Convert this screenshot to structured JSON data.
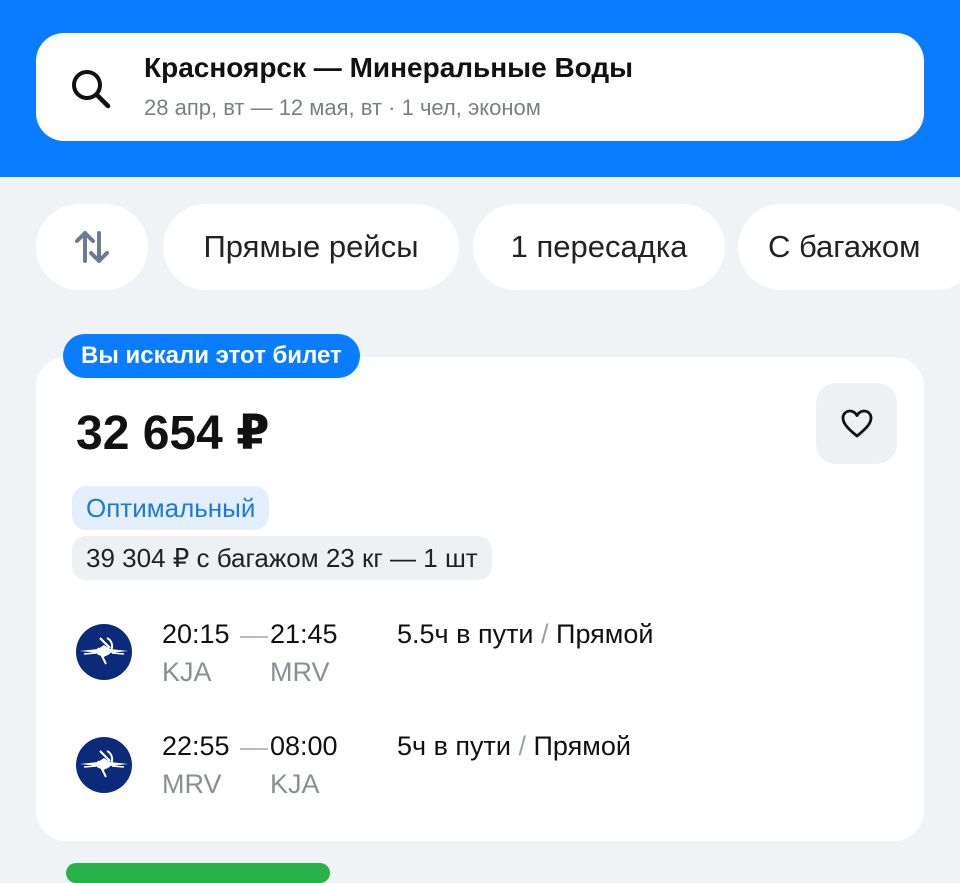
{
  "search": {
    "route": "Красноярск — Минеральные Воды",
    "details": "28 апр, вт — 12 мая, вт · 1 чел, эконом"
  },
  "filters": {
    "sort_icon": "sort-arrows-icon",
    "chips": [
      "Прямые рейсы",
      "1 пересадка",
      "С багажом"
    ]
  },
  "ticket": {
    "badge": "Вы искали этот билет",
    "price": "32 654 ₽",
    "tag": "Оптимальный",
    "baggage_price": "39 304 ₽ с багажом 23 кг — 1 шт",
    "favorite_icon": "heart-icon",
    "flights": [
      {
        "dep_time": "20:15",
        "arr_time": "21:45",
        "dep_code": "KJA",
        "arr_code": "MRV",
        "duration": "5.5ч в пути",
        "stops": "Прямой"
      },
      {
        "dep_time": "22:55",
        "arr_time": "08:00",
        "dep_code": "MRV",
        "arr_code": "KJA",
        "duration": "5ч в пути",
        "stops": "Прямой"
      }
    ]
  },
  "colors": {
    "brand_blue": "#0a7cff",
    "background": "#f0f3f6",
    "tag_blue": "#1e7ad6",
    "airline_navy": "#0b2a7a",
    "next_badge_green": "#2ab24a"
  }
}
